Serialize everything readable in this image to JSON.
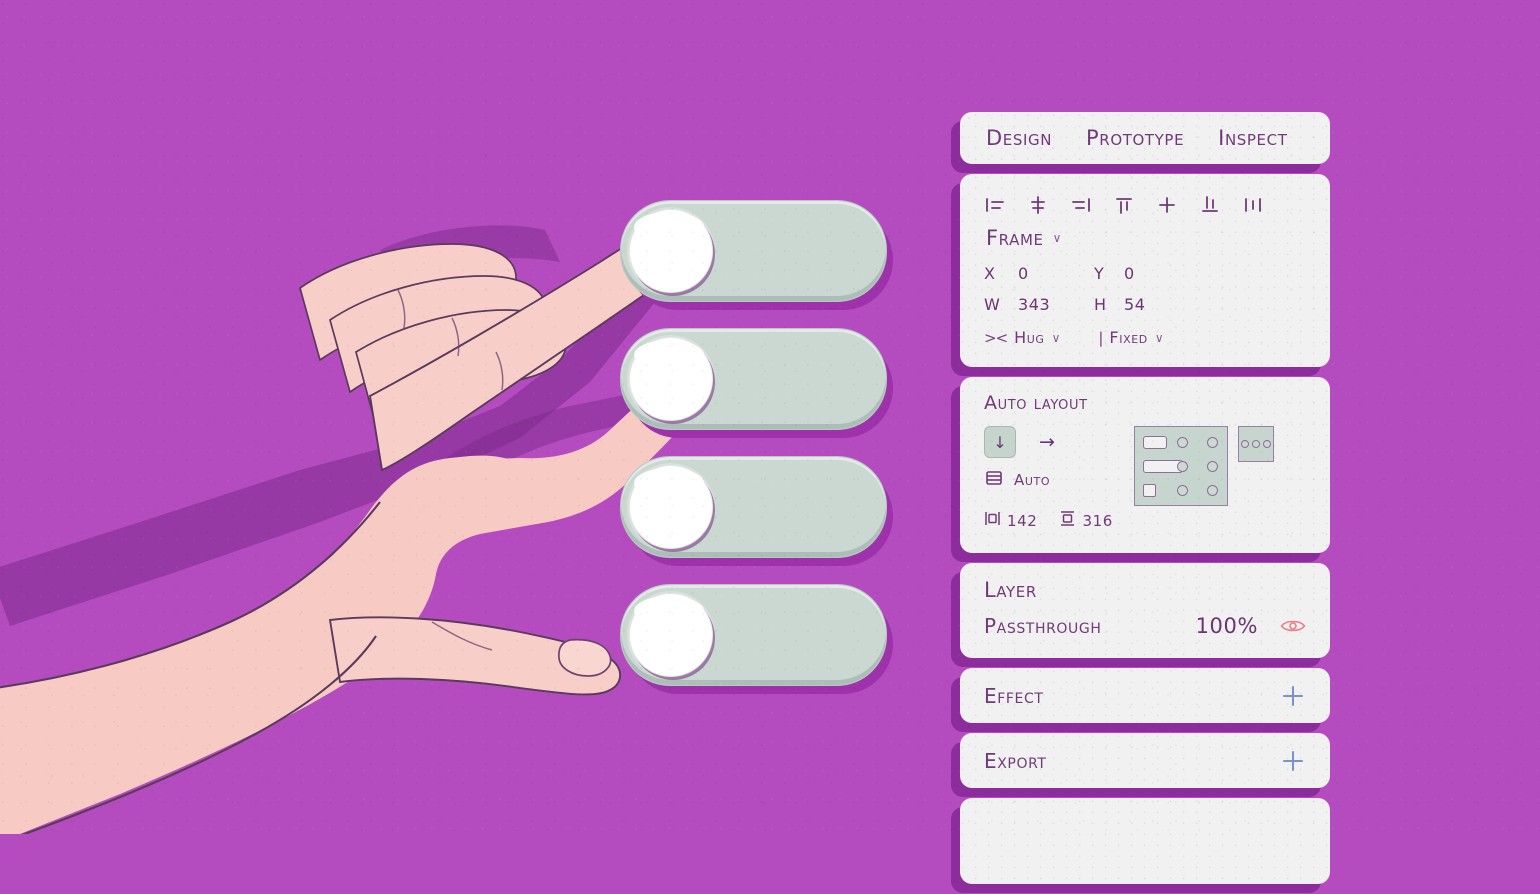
{
  "theme": {
    "background": "#b44cc0",
    "shadow_purple": "#8d2c9c",
    "panel_bg": "#f2f1f1",
    "ink": "#703a78",
    "toggle_track": "#cbd8d2",
    "toggle_knob": "#ffffff",
    "accent_blue": "#7b93c4",
    "eye_pink": "#e8808a",
    "autolayout_fill": "#c7d5cf"
  },
  "toggles": {
    "label": "toggle-switch",
    "items": [
      {
        "id": "toggle-1",
        "state": "off",
        "being_pressed": true
      },
      {
        "id": "toggle-2",
        "state": "off",
        "being_pressed": false
      },
      {
        "id": "toggle-3",
        "state": "off",
        "being_pressed": false
      },
      {
        "id": "toggle-4",
        "state": "off",
        "being_pressed": false
      }
    ]
  },
  "inspector": {
    "tabs": [
      {
        "label": "Design",
        "selected": true
      },
      {
        "label": "Prototype",
        "selected": false
      },
      {
        "label": "Inspect",
        "selected": false
      }
    ],
    "align_icons": [
      "align-left-icon",
      "align-horizontal-center-icon",
      "align-right-icon",
      "align-top-icon",
      "align-vertical-center-icon",
      "align-bottom-icon",
      "distribute-icon"
    ],
    "frame": {
      "title": "Frame",
      "caret": "∨",
      "x_label": "X",
      "x_value": "0",
      "y_label": "Y",
      "y_value": "0",
      "w_label": "W",
      "w_value": "343",
      "h_label": "H",
      "h_value": "54",
      "horizontal_resize_icon": "><",
      "horizontal_resize": "Hug",
      "horizontal_caret": "∨",
      "vertical_resize_icon": "|",
      "vertical_resize": "Fixed",
      "vertical_caret": "∨"
    },
    "auto_layout": {
      "title": "Auto layout",
      "direction_vertical_icon": "↓",
      "direction_horizontal_icon": "→",
      "spacing_icon": "spacing-rows-icon",
      "spacing_value": "Auto",
      "padding_horizontal_icon": "horizontal-padding-icon",
      "padding_horizontal": "142",
      "padding_vertical_icon": "vertical-padding-icon",
      "padding_vertical": "316"
    },
    "layer": {
      "title": "Layer",
      "blend_mode": "Passthrough",
      "opacity": "100%",
      "visibility_icon": "eye-icon"
    },
    "effect": {
      "title": "Effect",
      "add_icon": "plus-icon"
    },
    "export": {
      "title": "Export",
      "add_icon": "plus-icon"
    }
  }
}
